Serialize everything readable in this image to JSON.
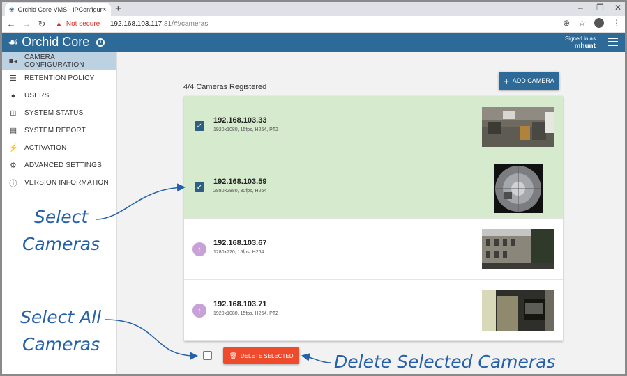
{
  "browser": {
    "tab_title": "Orchid Core VMS - IPConfigure",
    "tab_close": "×",
    "new_tab": "+",
    "not_secure": "Not secure",
    "url_host": "192.168.103.117",
    "url_rest": ":81/#!/cameras"
  },
  "header": {
    "app_name": "Orchid Core",
    "signed_in_label": "Signed in as",
    "username": "mhunt"
  },
  "sidebar": {
    "items": [
      {
        "label": "CAMERA CONFIGURATION",
        "icon": "video-camera-icon"
      },
      {
        "label": "RETENTION POLICY",
        "icon": "database-icon"
      },
      {
        "label": "USERS",
        "icon": "user-icon"
      },
      {
        "label": "SYSTEM STATUS",
        "icon": "medkit-icon"
      },
      {
        "label": "SYSTEM REPORT",
        "icon": "report-icon"
      },
      {
        "label": "ACTIVATION",
        "icon": "plug-icon"
      },
      {
        "label": "ADVANCED SETTINGS",
        "icon": "gears-icon"
      },
      {
        "label": "VERSION INFORMATION",
        "icon": "info-icon"
      }
    ]
  },
  "main": {
    "registered_count": "4/4 Cameras Registered",
    "add_camera_label": "ADD CAMERA",
    "delete_selected_label": "DELETE SELECTED",
    "cameras": [
      {
        "ip": "192.168.103.33",
        "specs": "1920x1080, 15fps, H264, PTZ",
        "selected": true
      },
      {
        "ip": "192.168.103.59",
        "specs": "2880x2880, 30fps, H264",
        "selected": true
      },
      {
        "ip": "192.168.103.67",
        "specs": "1280x720, 15fps, H264",
        "selected": false
      },
      {
        "ip": "192.168.103.71",
        "specs": "1920x1080, 15fps, H264, PTZ",
        "selected": false
      }
    ]
  },
  "annotations": {
    "select_cameras": [
      "Select",
      "Cameras"
    ],
    "select_all_cameras": [
      "Select All",
      "Cameras"
    ],
    "delete_selected_cameras": "Delete Selected Cameras"
  },
  "colors": {
    "appbar": "#2e6a97",
    "selected_row": "#d6ebcd",
    "delete_button": "#f04a2c",
    "annotation": "#2561a8"
  }
}
